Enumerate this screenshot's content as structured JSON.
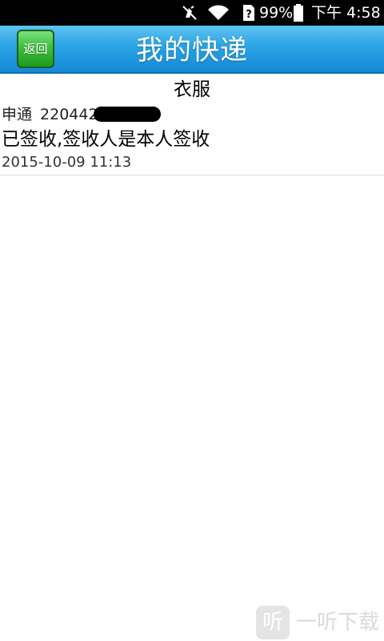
{
  "status_bar": {
    "icons": [
      "mute-icon",
      "wifi-icon",
      "sim-icon",
      "battery-icon"
    ],
    "battery": "99%",
    "clock": "下午 4:58"
  },
  "header": {
    "back_label": "返回",
    "title": "我的快递"
  },
  "package": {
    "category": "衣服",
    "courier": "申通",
    "tracking_visible": "220442",
    "status": "已签收,签收人是本人签收",
    "time": "2015-10-09 11:13"
  },
  "watermark": {
    "logo": "听",
    "text": "一听下载"
  },
  "colors": {
    "title_bar": "#2aa3e4",
    "back_button": "#3fbf3f",
    "status_bar": "#000000"
  }
}
